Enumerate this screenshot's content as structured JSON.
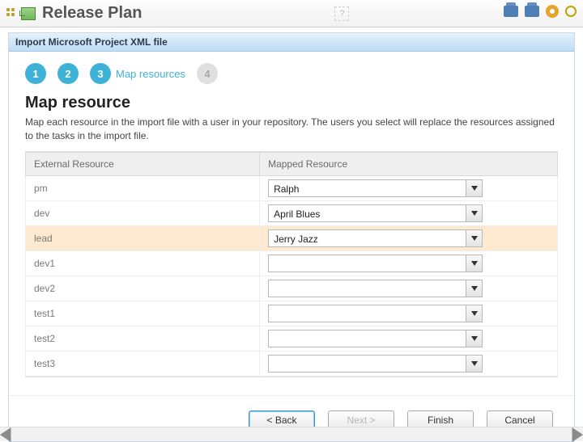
{
  "header": {
    "title": "Release Plan"
  },
  "dialog": {
    "title": "Import Microsoft Project XML file"
  },
  "wizard": {
    "steps": [
      {
        "num": "1"
      },
      {
        "num": "2"
      },
      {
        "num": "3",
        "label": "Map resources"
      },
      {
        "num": "4"
      }
    ],
    "section_title": "Map resource",
    "section_desc": "Map each resource in the import file with a user in your repository. The users you select will replace the resources assigned to the tasks in the import file."
  },
  "table": {
    "col_external": "External Resource",
    "col_mapped": "Mapped Resource",
    "rows": [
      {
        "ext": "pm",
        "mapped": "Ralph",
        "highlight": false
      },
      {
        "ext": "dev",
        "mapped": "April Blues",
        "highlight": false
      },
      {
        "ext": "lead",
        "mapped": "Jerry Jazz",
        "highlight": true
      },
      {
        "ext": "dev1",
        "mapped": "",
        "highlight": false
      },
      {
        "ext": "dev2",
        "mapped": "",
        "highlight": false
      },
      {
        "ext": "test1",
        "mapped": "",
        "highlight": false
      },
      {
        "ext": "test2",
        "mapped": "",
        "highlight": false
      },
      {
        "ext": "test3",
        "mapped": "",
        "highlight": false
      }
    ]
  },
  "buttons": {
    "back": "< Back",
    "next": "Next >",
    "finish": "Finish",
    "cancel": "Cancel"
  }
}
